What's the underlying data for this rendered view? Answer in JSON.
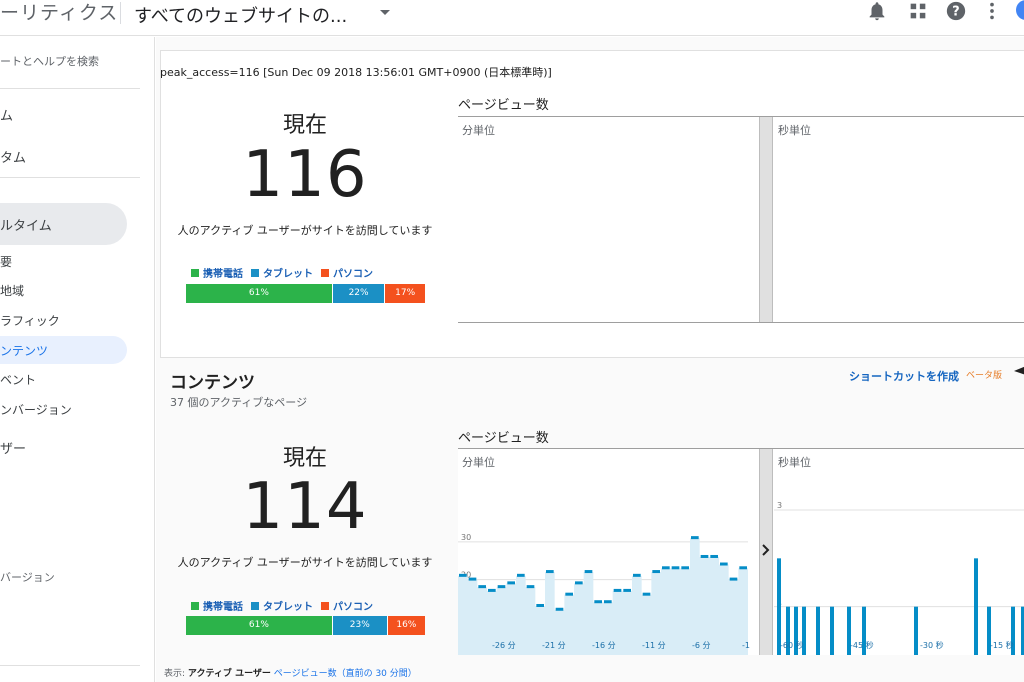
{
  "header": {
    "app_title": "ーリティクス",
    "property": "すべてのウェブサイトの...",
    "icons": [
      "bell-icon",
      "apps-grid-icon",
      "help-icon",
      "more-vert-icon",
      "avatar"
    ]
  },
  "sidebar": {
    "search": "ートとヘルプを検索",
    "items": [
      {
        "label": "ム"
      },
      {
        "label": "タム"
      },
      {
        "label": "ルタイム"
      },
      {
        "label": "要"
      },
      {
        "label": "地域"
      },
      {
        "label": "ラフィック"
      },
      {
        "label": "ンテンツ"
      },
      {
        "label": "ベント"
      },
      {
        "label": "ンバージョン"
      },
      {
        "label": "ザー"
      },
      {
        "label": "バージョン"
      }
    ]
  },
  "overview": {
    "peak": "peak_access=116 [Sun Dec 09 2018 13:56:01 GMT+0900 (日本標準時)]",
    "now_label": "現在",
    "count": "116",
    "desc": "人のアクティブ ユーザーがサイトを訪問しています",
    "legend": [
      "携帯電話",
      "タブレット",
      "パソコン"
    ],
    "devices": [
      {
        "label": "61%",
        "value": 61,
        "color": "#2cb34a"
      },
      {
        "label": "22%",
        "value": 22,
        "color": "#1b90c5"
      },
      {
        "label": "17%",
        "value": 17,
        "color": "#f4511e"
      }
    ],
    "pageviews_title": "ページビュー数",
    "per_minute": "分単位",
    "per_second": "秒単位"
  },
  "content": {
    "title": "コンテンツ",
    "subtitle": "37 個のアクティブなページ",
    "shortcut": "ショートカットを作成",
    "beta": "ベータ版",
    "now_label": "現在",
    "count": "114",
    "desc": "人のアクティブ ユーザーがサイトを訪問しています",
    "legend": [
      "携帯電話",
      "タブレット",
      "パソコン"
    ],
    "devices": [
      {
        "label": "61%",
        "value": 61,
        "color": "#2cb34a"
      },
      {
        "label": "23%",
        "value": 23,
        "color": "#1b90c5"
      },
      {
        "label": "16%",
        "value": 16,
        "color": "#f4511e"
      }
    ],
    "pageviews_title": "ページビュー数",
    "per_minute": "分単位",
    "per_second": "秒単位",
    "display_label": "表示:",
    "display_active": "アクティブ ユーザー",
    "display_link": "ページビュー数（直前の 30 分間）"
  },
  "chart_data": [
    {
      "type": "area",
      "title": "分単位",
      "ylim": [
        0,
        30
      ],
      "yticks": [
        "10",
        "20",
        "30"
      ],
      "xticks": [
        "-26 分",
        "-21 分",
        "-16 分",
        "-11 分",
        "-6 分",
        "-1"
      ],
      "x": [
        -30,
        -29,
        -28,
        -27,
        -26,
        -25,
        -24,
        -23,
        -22,
        -21,
        -20,
        -19,
        -18,
        -17,
        -16,
        -15,
        -14,
        -13,
        -12,
        -11,
        -10,
        -9,
        -8,
        -7,
        -6,
        -5,
        -4,
        -3,
        -2,
        -1
      ],
      "values": [
        21,
        20,
        18,
        17,
        18,
        19,
        21,
        18,
        13,
        22,
        12,
        16,
        19,
        22,
        14,
        14,
        17,
        17,
        21,
        16,
        22,
        23,
        23,
        23,
        31,
        26,
        26,
        24,
        20,
        23
      ]
    },
    {
      "type": "bar",
      "title": "秒単位",
      "ylim": [
        0,
        3
      ],
      "yticks": [
        "1",
        "3"
      ],
      "xticks": [
        "-60 秒",
        "-45 秒",
        "-30 秒",
        "-15 秒"
      ],
      "values": [
        2,
        1,
        1,
        1,
        1,
        1,
        1,
        1,
        1,
        2,
        1,
        1,
        1
      ]
    }
  ]
}
